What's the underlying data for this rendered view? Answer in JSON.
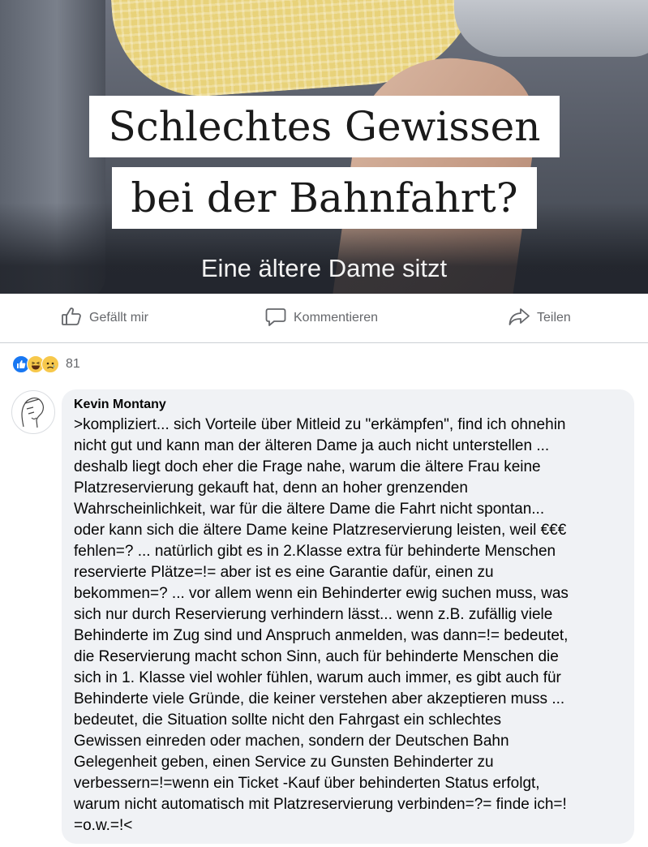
{
  "post": {
    "image": {
      "headline_line1": "Schlechtes Gewissen",
      "headline_line2": "bei der Bahnfahrt?",
      "subline": "Eine ältere Dame sitzt"
    },
    "actions": {
      "like_label": "Gefällt mir",
      "comment_label": "Kommentieren",
      "share_label": "Teilen"
    },
    "reactions": {
      "icons": [
        "like-icon",
        "haha-icon",
        "sad-icon"
      ],
      "count": "81"
    }
  },
  "comment": {
    "author": "Kevin Montany",
    "text": ">kompliziert... sich Vorteile über Mitleid zu \"erkämpfen\", find ich ohnehin\nnicht gut und kann man der älteren Dame ja auch nicht unterstellen ...\ndeshalb liegt doch eher die Frage nahe, warum die ältere Frau keine\nPlatzreservierung gekauft hat, denn an hoher grenzenden\nWahrscheinlichkeit,  war für die ältere Dame die Fahrt nicht spontan...\noder kann sich die ältere Dame keine Platzreservierung leisten, weil €€€\nfehlen=? ...  natürlich gibt es in 2.Klasse extra für behinderte Menschen\nreservierte Plätze=!= aber ist es eine Garantie dafür, einen zu\nbekommen=? ... vor allem wenn ein Behinderter ewig suchen muss, was\nsich nur durch Reservierung verhindern lässt... wenn z.B. zufällig viele\nBehinderte im Zug sind und Anspruch anmelden, was dann=!= bedeutet,\ndie Reservierung macht schon Sinn, auch für behinderte Menschen die\nsich in 1. Klasse viel wohler fühlen, warum auch immer, es gibt auch für\nBehinderte viele Gründe, die keiner verstehen aber akzeptieren muss ...\nbedeutet, die Situation sollte nicht den Fahrgast ein schlechtes\nGewissen einreden oder machen, sondern der Deutschen Bahn\nGelegenheit geben, einen Service zu Gunsten Behinderter zu\nverbessern=!=wenn ein Ticket -Kauf über behinderten Status erfolgt,\nwarum nicht automatisch mit Platzreservierung verbinden=?= finde ich=!\n=o.w.=!<"
  },
  "colors": {
    "bubble_bg": "#f0f2f5",
    "muted_text": "#65676b",
    "like_blue": "#1877f2",
    "emoji_yellow": "#f7c84b"
  }
}
